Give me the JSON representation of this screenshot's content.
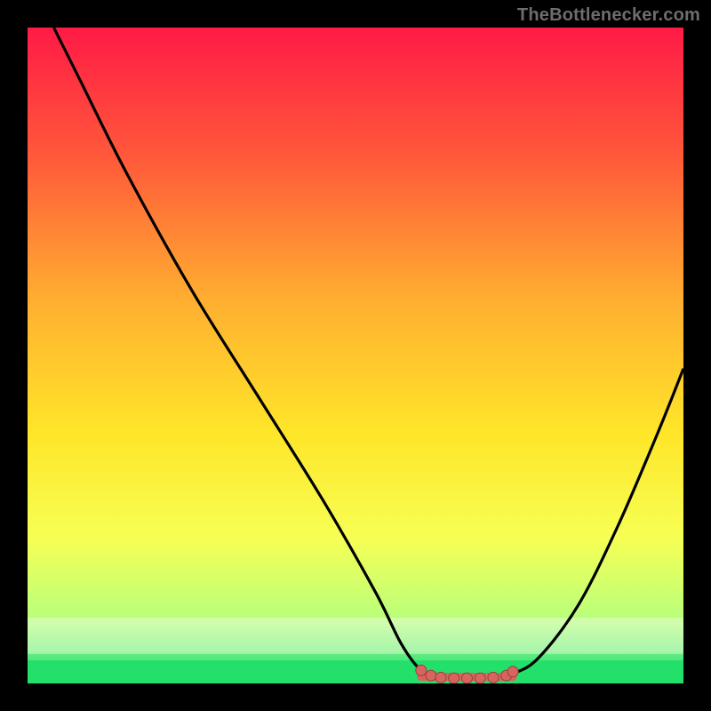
{
  "attribution": "TheBottlenecker.com",
  "colors": {
    "frame": "#000000",
    "curve": "#000000",
    "marker_fill": "#d6655f",
    "marker_stroke": "#9e3e3a",
    "green_band": "#22e06a",
    "white_band": "#f8ffe6"
  },
  "chart_data": {
    "type": "line",
    "title": "",
    "xlabel": "",
    "ylabel": "",
    "xlim": [
      0,
      100
    ],
    "ylim": [
      0,
      100
    ],
    "gradient_stops": [
      {
        "offset": 0.0,
        "color": "#ff1a46"
      },
      {
        "offset": 0.2,
        "color": "#ff5a3a"
      },
      {
        "offset": 0.42,
        "color": "#ffb030"
      },
      {
        "offset": 0.62,
        "color": "#ffe629"
      },
      {
        "offset": 0.78,
        "color": "#f6ff55"
      },
      {
        "offset": 0.9,
        "color": "#b9ff7b"
      },
      {
        "offset": 0.965,
        "color": "#4fe87e"
      },
      {
        "offset": 1.0,
        "color": "#16c65f"
      }
    ],
    "curve": [
      {
        "x": 4.0,
        "y": 100.0
      },
      {
        "x": 8.0,
        "y": 92.0
      },
      {
        "x": 15.0,
        "y": 78.0
      },
      {
        "x": 25.0,
        "y": 60.0
      },
      {
        "x": 35.0,
        "y": 44.0
      },
      {
        "x": 45.0,
        "y": 28.0
      },
      {
        "x": 53.0,
        "y": 14.0
      },
      {
        "x": 57.0,
        "y": 6.0
      },
      {
        "x": 60.0,
        "y": 2.0
      },
      {
        "x": 63.0,
        "y": 0.8
      },
      {
        "x": 70.0,
        "y": 0.8
      },
      {
        "x": 74.0,
        "y": 1.5
      },
      {
        "x": 78.0,
        "y": 4.0
      },
      {
        "x": 84.0,
        "y": 12.0
      },
      {
        "x": 90.0,
        "y": 24.0
      },
      {
        "x": 96.0,
        "y": 38.0
      },
      {
        "x": 100.0,
        "y": 48.0
      }
    ],
    "flat_region": {
      "x_start": 60.0,
      "x_end": 74.0,
      "y": 1.0
    },
    "markers": [
      {
        "x": 60.0,
        "y": 2.0
      },
      {
        "x": 61.5,
        "y": 1.2
      },
      {
        "x": 63.0,
        "y": 0.9
      },
      {
        "x": 65.0,
        "y": 0.8
      },
      {
        "x": 67.0,
        "y": 0.8
      },
      {
        "x": 69.0,
        "y": 0.8
      },
      {
        "x": 71.0,
        "y": 0.9
      },
      {
        "x": 73.0,
        "y": 1.2
      },
      {
        "x": 74.0,
        "y": 1.8
      }
    ]
  }
}
